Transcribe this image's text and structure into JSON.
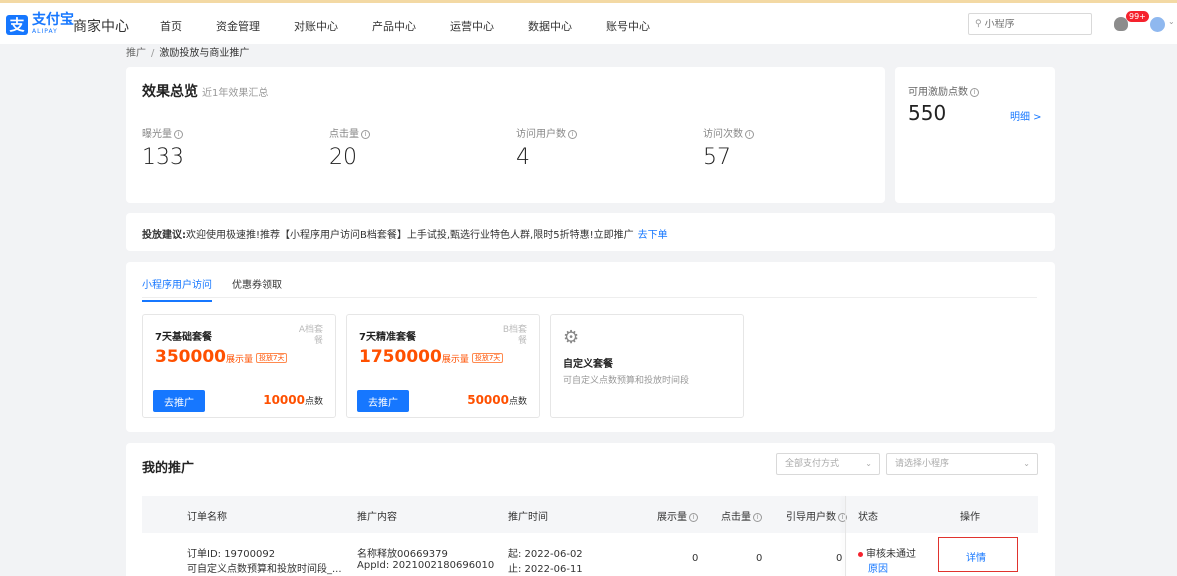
{
  "header": {
    "logo_cn": "支付宝",
    "logo_en": "ALIPAY",
    "center_title": "商家中心",
    "nav": [
      "首页",
      "资金管理",
      "对账中心",
      "产品中心",
      "运营中心",
      "数据中心",
      "账号中心"
    ],
    "search_placeholder": "小程序",
    "notification_badge": "99+"
  },
  "breadcrumb": {
    "parent": "推广",
    "separator": "/",
    "current": "激励投放与商业推广"
  },
  "overview": {
    "title": "效果总览",
    "subtitle": "近1年效果汇总",
    "metrics": [
      {
        "label": "曝光量",
        "value": "133"
      },
      {
        "label": "点击量",
        "value": "20"
      },
      {
        "label": "访问用户数",
        "value": "4"
      },
      {
        "label": "访问次数",
        "value": "57"
      }
    ]
  },
  "points": {
    "label": "可用激励点数",
    "value": "550",
    "detail": "明细 >"
  },
  "advice": {
    "label": "投放建议:",
    "text": "欢迎使用极速推!推荐【小程序用户访问B档套餐】上手试投,甄选行业特色人群,限时5折特惠!立即推广",
    "link": "去下单"
  },
  "packages": {
    "tabs": [
      "小程序用户访问",
      "优惠券领取"
    ],
    "active_tab": 0,
    "items": [
      {
        "name": "7天基础套餐",
        "tier": "A档套餐",
        "amount": "350000",
        "unit": "展示量",
        "duration": "投放7天",
        "button": "去推广",
        "points": "10000",
        "points_unit": "点数"
      },
      {
        "name": "7天精准套餐",
        "tier": "B档套餐",
        "amount": "1750000",
        "unit": "展示量",
        "duration": "投放7天",
        "button": "去推广",
        "points": "50000",
        "points_unit": "点数"
      }
    ],
    "custom": {
      "name": "自定义套餐",
      "desc": "可自定义点数预算和投放时间段"
    }
  },
  "my_promotion": {
    "title": "我的推广",
    "filter_pay": "全部支付方式",
    "filter_app": "请选择小程序",
    "columns": [
      "订单名称",
      "推广内容",
      "推广时间",
      "展示量",
      "点击量",
      "引导用户数",
      "状态",
      "操作"
    ],
    "rows": [
      {
        "order_id": "订单ID: 19700092",
        "order_desc": "可自定义点数预算和投放时间段_...",
        "content_name": "名称释放00669379",
        "content_appid": "AppId: 2021002180696010",
        "start": "起: 2022-06-02",
        "end": "止: 2022-06-11",
        "impressions": "0",
        "clicks": "0",
        "users": "0",
        "status": "审核未通过",
        "status_reason": "原因",
        "action": "详情"
      }
    ]
  },
  "colors": {
    "accent": "#1677ff",
    "orange": "#ff5000",
    "error": "#f5222d"
  }
}
